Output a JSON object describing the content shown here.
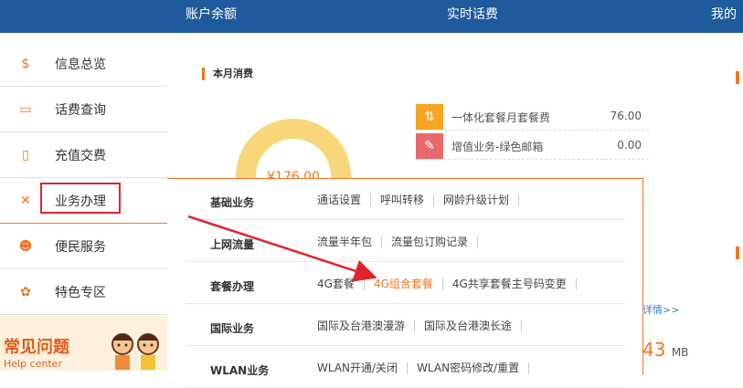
{
  "topnav": {
    "tab1": "账户余额",
    "tab2": "实时话费",
    "tab3": "我的积"
  },
  "sidebar": {
    "items": [
      {
        "label": "信息总览",
        "icon": "dollar-icon"
      },
      {
        "label": "话费查询",
        "icon": "bill-icon"
      },
      {
        "label": "充值交费",
        "icon": "phone-icon"
      },
      {
        "label": "业务办理",
        "icon": "tools-icon"
      },
      {
        "label": "便民服务",
        "icon": "people-icon"
      },
      {
        "label": "特色专区",
        "icon": "gear-icon"
      }
    ],
    "faq": "常见问题",
    "faq_sub": "Help center"
  },
  "main": {
    "title": "本月消费",
    "donut_text": "¥176.00",
    "costs": [
      {
        "name": "一体化套餐月套餐费",
        "value": "76.00",
        "color": "#f6a623",
        "icon": "swap-icon"
      },
      {
        "name": "增值业务-绿色邮箱",
        "value": "0.00",
        "color": "#e8686c",
        "icon": "clip-icon"
      }
    ],
    "detail_link": "详情>>",
    "data_value": "43",
    "data_unit": "MB"
  },
  "panel": {
    "rows": [
      {
        "category": "基础业务",
        "links": [
          "通话设置",
          "呼叫转移",
          "网龄升级计划"
        ]
      },
      {
        "category": "上网流量",
        "links": [
          "流量半年包",
          "流量包订购记录"
        ]
      },
      {
        "category": "套餐办理",
        "links": [
          "4G套餐",
          "4G组合套餐",
          "4G共享套餐主号码变更"
        ]
      },
      {
        "category": "国际业务",
        "links": [
          "国际及台港澳漫游",
          "国际及台港澳长途"
        ]
      },
      {
        "category": "WLAN业务",
        "links": [
          "WLAN开通/关闭",
          "WLAN密码修改/重置"
        ]
      }
    ]
  },
  "colors": {
    "accent": "#f37521",
    "nav": "#1e5a9c",
    "annotation": "#e1242b"
  }
}
